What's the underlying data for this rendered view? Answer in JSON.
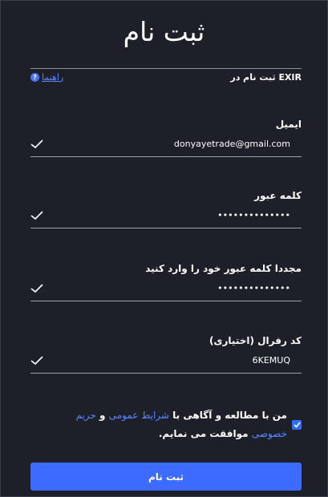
{
  "page": {
    "title": "ثبت نام",
    "subtitle": "ثبت نام در EXIR",
    "help_link": "راهنما",
    "help_icon": "question-circle-icon",
    "accent": "#3d6bff"
  },
  "form": {
    "email": {
      "label": "ایمیل",
      "value": "donyayetrade@gmail.com"
    },
    "password": {
      "label": "کلمه عبور",
      "value": "••••••••••••••"
    },
    "password_confirm": {
      "label": "مجددا کلمه عبور خود را وارد کنید",
      "value": "••••••••••••••"
    },
    "referral": {
      "label": "کد رفرال (اختیاری)",
      "value": "6KEMUQ"
    }
  },
  "agreement": {
    "prefix": "من با مطالعه و آگاهی با ",
    "terms_link": "شرایط عمومی",
    "and": " و ",
    "privacy_link": "حریم خصوصی",
    "suffix": " موافقت می نمایم.",
    "checked": true
  },
  "submit_label": "ثبت نام"
}
